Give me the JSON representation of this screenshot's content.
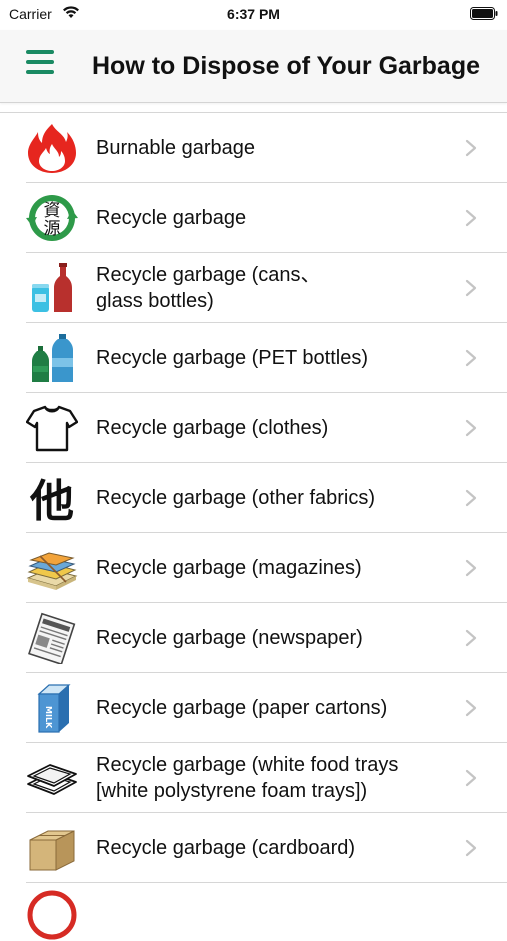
{
  "status_bar": {
    "carrier": "Carrier",
    "time": "6:37 PM"
  },
  "header": {
    "title": "How to Dispose of Your Garbage"
  },
  "items": [
    {
      "label": "Burnable garbage",
      "icon": "fire-icon"
    },
    {
      "label": "Recycle garbage",
      "icon": "recycle-kanji-icon",
      "icon_text": [
        "資",
        "源"
      ]
    },
    {
      "label": "Recycle garbage (cans、\nglass bottles)",
      "icon": "can-bottle-icon"
    },
    {
      "label": "Recycle garbage (PET bottles)",
      "icon": "pet-bottles-icon"
    },
    {
      "label": "Recycle garbage (clothes)",
      "icon": "tshirt-icon"
    },
    {
      "label": "Recycle garbage (other fabrics)",
      "icon": "other-kanji-icon",
      "icon_text": "他"
    },
    {
      "label": "Recycle garbage (magazines)",
      "icon": "magazines-icon"
    },
    {
      "label": "Recycle garbage (newspaper)",
      "icon": "newspaper-icon"
    },
    {
      "label": "Recycle garbage (paper cartons)",
      "icon": "milk-carton-icon",
      "icon_text": "MILK"
    },
    {
      "label": "Recycle garbage (white food trays\n[white polystyrene foam trays])",
      "icon": "food-tray-icon"
    },
    {
      "label": "Recycle garbage (cardboard)",
      "icon": "cardboard-box-icon"
    }
  ],
  "colors": {
    "accent": "#1a8a63",
    "separator": "#d6d6d6",
    "nav_background": "#f7f7f7",
    "chevron": "#c4c4c4"
  }
}
